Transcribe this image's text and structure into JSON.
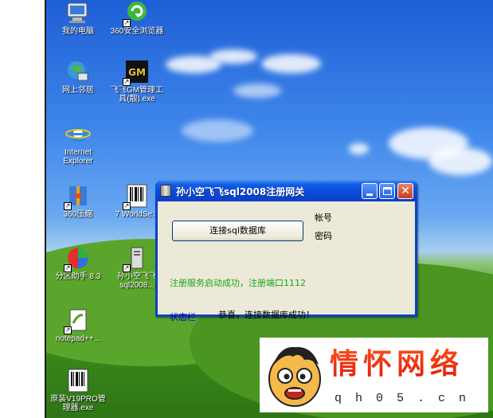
{
  "desktop": {
    "icons": [
      {
        "label": "我的电脑",
        "icon": "my-computer-icon"
      },
      {
        "label": "360安全浏览器",
        "icon": "browser-360-icon"
      },
      {
        "label": "网上邻居",
        "icon": "network-places-icon"
      },
      {
        "label": "飞飞GM管理工具(靓).exe",
        "icon": "gm-tool-icon",
        "badge": "GM"
      },
      {
        "label": "Internet Explorer",
        "icon": "internet-explorer-icon"
      },
      {
        "label": "360压缩",
        "icon": "zip-360-icon"
      },
      {
        "label": "7 WorldSe...",
        "icon": "barcode-app-icon"
      },
      {
        "label": "分区助手 8.3",
        "icon": "partition-assistant-icon"
      },
      {
        "label": "孙小空飞飞sql2008...",
        "icon": "server-app-icon"
      },
      {
        "label": "notepad++...",
        "icon": "notepadpp-icon"
      },
      {
        "label": "原装V19PRO管理器.exe",
        "icon": "barcode-manager-icon"
      }
    ]
  },
  "window": {
    "title": "孙小空飞飞sql2008注册网关",
    "connect_button": "连接sql数据库",
    "account_label": "帐号",
    "password_label": "密码",
    "success_text": "注册服务启动成功，注册端口1112",
    "status_label": "状态栏",
    "status_message": "恭喜，连接数据库成功！"
  },
  "watermark": {
    "title": "情怀网络",
    "url": "qh05.cn"
  },
  "colors": {
    "titlebar": "#0a4ad8",
    "success": "#16a516",
    "status_label": "#0000c8",
    "watermark_red": "#e0180c"
  }
}
